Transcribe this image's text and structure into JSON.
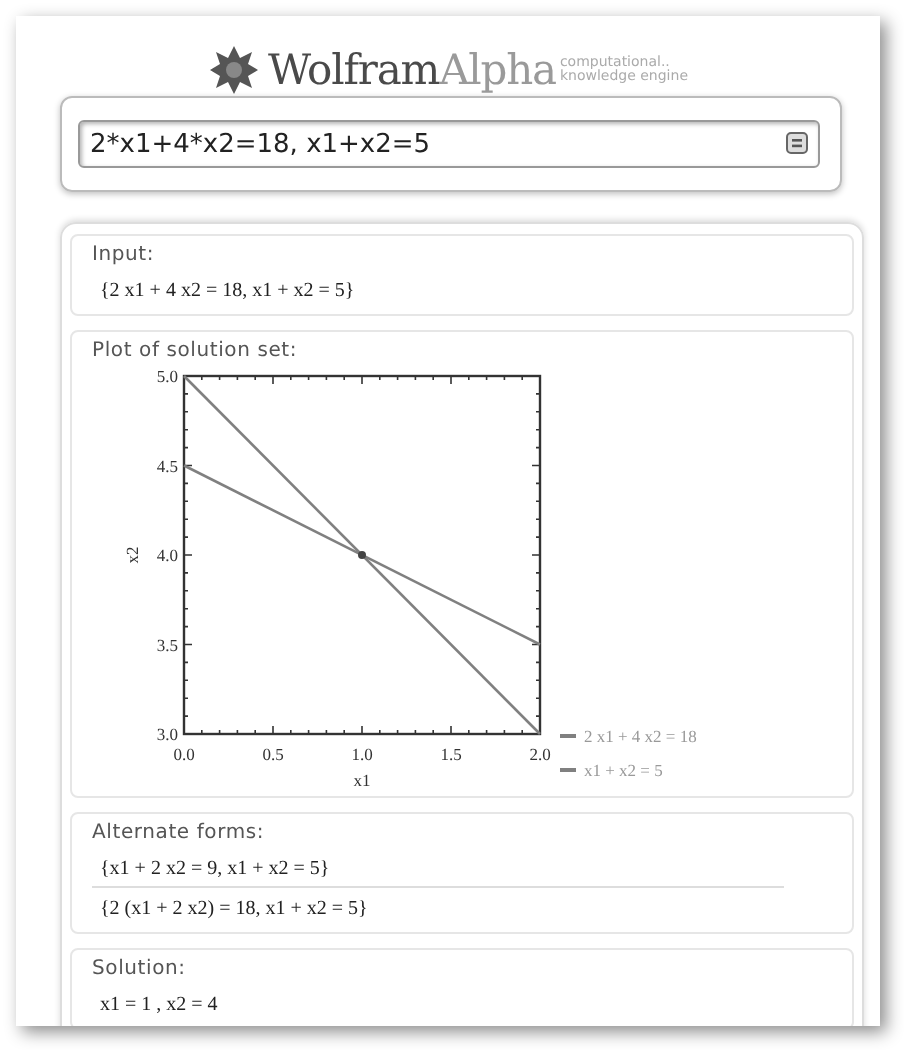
{
  "logo": {
    "name_1": "Wolfram",
    "name_2": "Alpha",
    "tagline": [
      "computational..",
      "knowledge engine"
    ]
  },
  "search": {
    "value": "2*x1+4*x2=18, x1+x2=5"
  },
  "pods": [
    {
      "kind": "text",
      "title": "Input:",
      "lines": [
        "{2 x1 + 4 x2 = 18, x1 + x2 = 5}"
      ]
    },
    {
      "kind": "chart",
      "title": "Plot of solution set:",
      "chart_data": {
        "type": "line",
        "xlabel": "x1",
        "ylabel": "x2",
        "x": [
          0,
          2
        ],
        "series": [
          {
            "name": "2 x1 + 4 x2 = 18",
            "color": "#808080",
            "values": [
              4.5,
              3.5
            ]
          },
          {
            "name": "x1 + x2 = 5",
            "color": "#808080",
            "values": [
              5,
              3
            ]
          }
        ],
        "xlim": [
          0,
          2
        ],
        "ylim": [
          3,
          5
        ],
        "xticks": [
          {
            "value": 0,
            "label": "0.0"
          },
          {
            "value": 0.5,
            "label": "0.5"
          },
          {
            "value": 1,
            "label": "1.0"
          },
          {
            "value": 1.5,
            "label": "1.5"
          },
          {
            "value": 2,
            "label": "2.0"
          }
        ],
        "yticks": [
          {
            "value": 3,
            "label": "3.0"
          },
          {
            "value": 3.5,
            "label": "3.5"
          },
          {
            "value": 4,
            "label": "4.0"
          },
          {
            "value": 4.5,
            "label": "4.5"
          },
          {
            "value": 5,
            "label": "5.0"
          }
        ],
        "legend": "bottom-right"
      }
    },
    {
      "kind": "text",
      "title": "Alternate forms:",
      "lines": [
        "{x1 + 2 x2 = 9, x1 + x2 = 5}",
        "{2 (x1 + 2 x2) = 18, x1 + x2 = 5}"
      ]
    },
    {
      "kind": "text",
      "title": "Solution:",
      "lines": [
        "x1 = 1 ,    x2 = 4"
      ]
    }
  ]
}
